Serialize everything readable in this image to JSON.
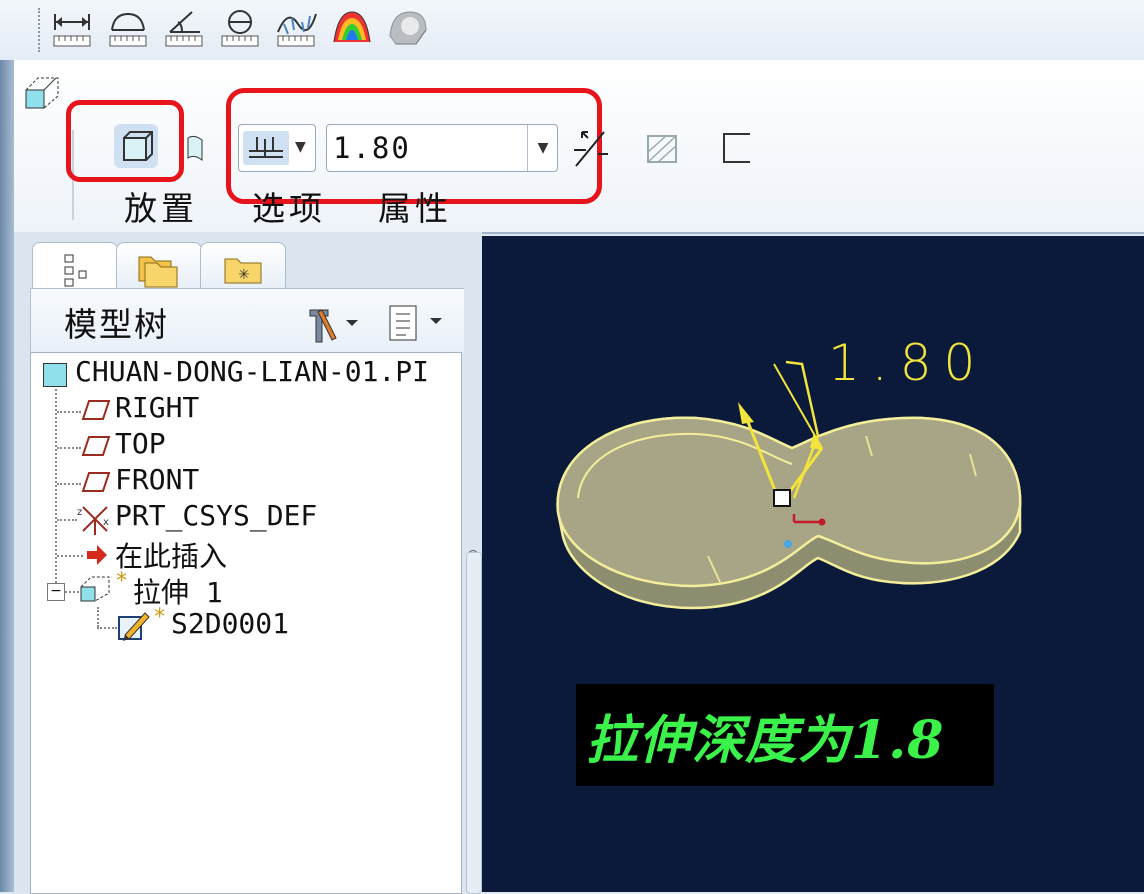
{
  "measure_toolbar": {
    "tools": [
      "distance-measure-icon",
      "length-measure-icon",
      "angle-measure-icon",
      "diameter-measure-icon",
      "curve-analysis-icon",
      "surface-analysis-icon",
      "shaded-analysis-icon"
    ]
  },
  "dashboard": {
    "tabs": {
      "placement": "放置",
      "options": "选项",
      "properties": "属性"
    },
    "depth_value": "1.80",
    "highlight_color": "#e8141c"
  },
  "navigator": {
    "title": "模型树",
    "tree": {
      "root": "CHUAN-DONG-LIAN-01.PI",
      "items": [
        {
          "label": "RIGHT",
          "icon": "datum-plane-icon"
        },
        {
          "label": "TOP",
          "icon": "datum-plane-icon"
        },
        {
          "label": "FRONT",
          "icon": "datum-plane-icon"
        },
        {
          "label": "PRT_CSYS_DEF",
          "icon": "coordinate-system-icon"
        },
        {
          "label": "在此插入",
          "icon": "insert-here-arrow-icon"
        }
      ],
      "feature": {
        "star": "*",
        "label": "拉伸 1"
      },
      "sketch": {
        "star": "*",
        "label": "S2D0001"
      }
    }
  },
  "graphics": {
    "dimension": "1.80",
    "note": "拉伸深度为1.8",
    "colors": {
      "background": "#0b1a3a",
      "dimension": "#f2e43c",
      "note_text": "#3af24a",
      "model": "#a7a585"
    }
  }
}
